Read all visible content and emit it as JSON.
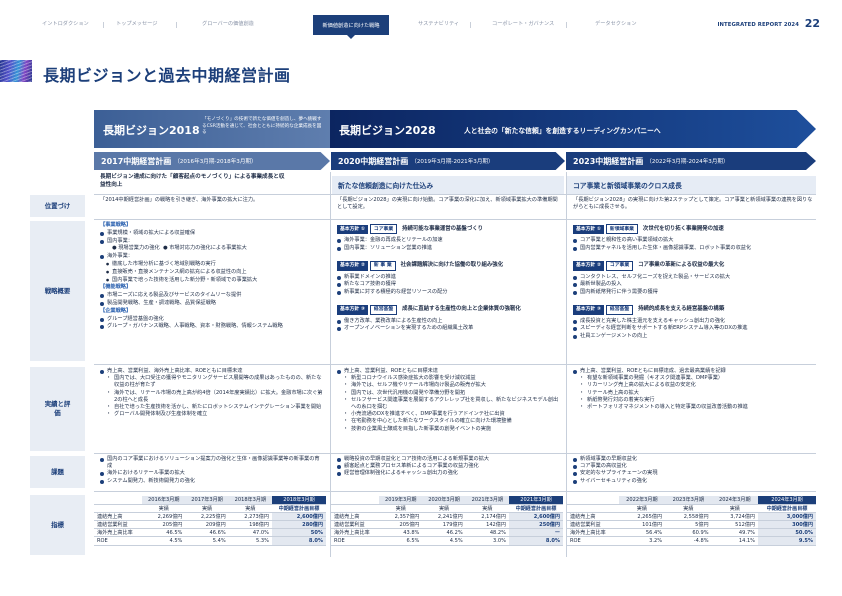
{
  "nav": {
    "items": [
      "イントロダクション",
      "トップメッセージ",
      "グローバーの価値創造",
      "新価値創造に向けた戦略",
      "サステナビリティ",
      "コーポレート・ガバナンス",
      "データセクション"
    ],
    "active_index": 3,
    "report_title": "INTEGRATED REPORT 2024",
    "page_number": "22"
  },
  "page_title": "長期ビジョンと過去中期経営計画",
  "vision2018": {
    "title": "長期ビジョン2018",
    "desc": "「モノづくり」の技術で新たな価値を創造し、夢へ挑戦するCSR活動を通じて、社会とともに持続的な企業成長を図る"
  },
  "vision2028": {
    "title": "長期ビジョン2028",
    "desc": "人と社会の「新たな信頼」を創造するリーディングカンパニーへ"
  },
  "plans": [
    {
      "title": "2017中期経営計画",
      "period": "（2016年3月期-2018年3月期）"
    },
    {
      "title": "2020中期経営計画",
      "period": "（2019年3月期-2021年3月期）"
    },
    {
      "title": "2023中期経営計画",
      "period": "（2022年3月期-2024年3月期）"
    }
  ],
  "row_labels": {
    "position": "位置づけ",
    "strategy": "戦略概要",
    "results": "実績と評価",
    "issues": "課題",
    "indicators": "指標"
  },
  "plan1": {
    "subtitle": "長期ビジョン達成に向けた「顧客起点のモノづくり」による事業成長と収益性向上",
    "position": "「2014中期経営計画」の戦略を引き継ぎ、海外事業の拡大に注力。",
    "strategy": {
      "biz_head": "【事業戦略】",
      "biz_items": [
        "事業規模・領域の拡大による収益確保",
        "国内事業："
      ],
      "domestic_subs": [
        "現場営業力の強化",
        "市場対応力の強化による事業拡大"
      ],
      "overseas": "海外事業：",
      "overseas_subs": [
        "徹底した市場分析に基づく地域別戦略の実行",
        "直接販売・直接メンテナンス網の拡充による収益性の向上",
        "国内事業で培った技術を活用した新分野・新領域での事業拡大"
      ],
      "func_head": "【機能戦略】",
      "func_items": [
        "市場ニーズに応える製品及びサービスのタイムリーな提供",
        "製品開発戦略、生産・調達戦略、品質保証戦略"
      ],
      "corp_head": "【企業戦略】",
      "corp_items": [
        "グループ経営基盤の強化",
        "グループ・ガバナンス戦略、人事戦略、資本・財務戦略、情報システム戦略"
      ]
    },
    "results": {
      "main": "売上高、営業利益、海外売上高比率、ROEともに目標未達",
      "subs": [
        "国内では、大口受注の獲得やモニタリングサービス展開等の成果はあったものの、新たな収益の柱が育たず",
        "海外では、リテール市場の売上高が約4倍（2014年度実績比）に拡大。金融市場に次ぐ第2の柱へと成長",
        "自社で培った生産技術を活かし、新たにロボットシステムインテグレーション事業を開始",
        "グローバル開発体制及び生産体制を確立"
      ]
    },
    "issues": [
      "国内のコア事業におけるソリューション提案力の強化と生体・画像認識事業等の新事業の育成",
      "海外におけるリテール事業の拡大",
      "システム開発力、新技術開発力の強化"
    ]
  },
  "plan2": {
    "subtitle": "新たな信頼創造に向けた仕込み",
    "position": "「長期ビジョン2028」の実現に向け始動。コア事業の深化に加え、新領域事業拡大の準備期間として設定。",
    "policies": [
      {
        "badge": "基本方針 ①",
        "tag": "コア事業",
        "title": "持続可能な事業運営の基盤づくり",
        "items": [
          "海外事業：金融の再成長とリテールの加速",
          "国内事業：ソリューション営業の推進"
        ]
      },
      {
        "badge": "基本方針 ②",
        "tag": "新 事 業",
        "title": "社会課題解決に向けた協働の取り組み強化",
        "items": [
          "新事業ドメインの推進",
          "新たなコア技術の獲得",
          "新事業に対する積極的な経営リソースの配分"
        ]
      },
      {
        "badge": "基本方針 ③",
        "tag": "経営基盤",
        "title": "成長に直結する生産性の向上と企業体質の強靭化",
        "items": [
          "働き方改革、業務改革による生産性の向上",
          "オープンイノベーションを実現するための組織風土改革"
        ]
      }
    ],
    "results": {
      "main": "売上高、営業利益、ROEともに目標未達",
      "subs": [
        "新型コロナウイルス感染症拡大の影響を受け減収減益",
        "海外では、セルフ機やリテール市場向け製品の販売が拡大",
        "国内では、次世代汎用機の開発や準備分野を開拓",
        "セルフサービス関連事業を展開するアクレレップ社を買収し、新たなビジネスモデル創出への糸口を掴む",
        "小売流通のDXを推進すべく、DMP事業を行うアドインテ社に出資",
        "在宅勤務を中心とした新たなワークスタイルの確立に向けた環境整備",
        "技術の企業風土醸成を目指した新事業の創発イベントの実施"
      ]
    },
    "issues": [
      "戦略投資の早期収益化とコア技術の活用による新規事業の拡大",
      "顧客起点と業務プロセス革新によるコア事業の収益力強化",
      "経営管理体制強化によるキャッシュ創出力の強化"
    ]
  },
  "plan3": {
    "subtitle": "コア事業と新領域事業のクロス成長",
    "position": "「長期ビジョン2028」の実現に向けた第2ステップとして策定。コア事業と新領域事業の連携を図りながらともに成長させる。",
    "policies": [
      {
        "badge": "基本方針 ①",
        "tag": "新領域事業",
        "title": "次世代を切り拓く事業開発の加速",
        "items": [
          "コア事業と親和性の高い事業領域の拡大",
          "国内営業チャネルを活用した生体・画像認識事業、ロボット事業の収益化"
        ]
      },
      {
        "badge": "基本方針 ②",
        "tag": "コア事業",
        "title": "コア事業の革新による収益の最大化",
        "items": [
          "コンタクトレス、セルフ化ニーズを捉えた製品・サービスの拡大",
          "最新世製品の投入",
          "国内新紙幣発行に伴う需要の獲得"
        ]
      },
      {
        "badge": "基本方針 ③",
        "tag": "経営基盤",
        "title": "持続的成長を支える経営基盤の構築",
        "items": [
          "成長投資と充実した株主還元を支えるキャッシュ創出力の強化",
          "スピーディな経営判断をサポートする新ERPシステム導入等のDXの推進",
          "社員エンゲージメントの向上"
        ]
      }
    ],
    "results": {
      "main": "売上高、営業利益、ROEともに目標達成、過去最高業績を記録",
      "subs": [
        "有望な新領域事業の発掘（キオスク関連事業、DMP事業）",
        "リカーリング売上高の拡大による収益の安定化",
        "リテール売上高の拡大",
        "新紙幣発行対応の着実な実行",
        "ポートフォリオマネジメントの導入と特定事業の収益改善活動の推進"
      ]
    },
    "issues": [
      "新領域事業の早期収益化",
      "コア事業の高収益化",
      "安定的なサプライチェーンの実現",
      "サイバーセキュリティの強化"
    ]
  },
  "tables": [
    {
      "periods": [
        "2016年3月期",
        "2017年3月期",
        "2018年3月期",
        "2018年3月期"
      ],
      "kinds": [
        "実績",
        "実績",
        "実績",
        "中期経営計画目標"
      ],
      "rows": [
        {
          "label": "連結売上高",
          "values": [
            "2,269億円",
            "2,225億円",
            "2,273億円",
            "2,600億円"
          ]
        },
        {
          "label": "連結営業利益",
          "values": [
            "205億円",
            "209億円",
            "198億円",
            "280億円"
          ]
        },
        {
          "label": "海外売上高比率",
          "values": [
            "46.5%",
            "46.6%",
            "47.0%",
            "50%"
          ]
        },
        {
          "label": "ROE",
          "values": [
            "4.5%",
            "5.4%",
            "5.3%",
            "8.0%"
          ]
        }
      ]
    },
    {
      "periods": [
        "2019年3月期",
        "2020年3月期",
        "2021年3月期",
        "2021年3月期"
      ],
      "kinds": [
        "実績",
        "実績",
        "実績",
        "中期経営計画目標"
      ],
      "rows": [
        {
          "label": "連結売上高",
          "values": [
            "2,357億円",
            "2,241億円",
            "2,174億円",
            "2,600億円"
          ]
        },
        {
          "label": "連結営業利益",
          "values": [
            "205億円",
            "179億円",
            "142億円",
            "250億円"
          ]
        },
        {
          "label": "海外売上高比率",
          "values": [
            "43.8%",
            "46.2%",
            "48.2%",
            "ー"
          ]
        },
        {
          "label": "ROE",
          "values": [
            "6.5%",
            "4.5%",
            "3.0%",
            "8.0%"
          ]
        }
      ]
    },
    {
      "periods": [
        "2022年3月期",
        "2023年3月期",
        "2024年3月期",
        "2024年3月期"
      ],
      "kinds": [
        "実績",
        "実績",
        "実績",
        "中期経営計画目標"
      ],
      "rows": [
        {
          "label": "連結売上高",
          "values": [
            "2,265億円",
            "2,558億円",
            "3,724億円",
            "3,000億円"
          ]
        },
        {
          "label": "連結営業利益",
          "values": [
            "101億円",
            "5億円",
            "512億円",
            "300億円"
          ]
        },
        {
          "label": "海外売上高比率",
          "values": [
            "56.4%",
            "60.9%",
            "49.7%",
            "50.0%"
          ]
        },
        {
          "label": "ROE",
          "values": [
            "3.2%",
            "-4.8%",
            "14.1%",
            "9.5%"
          ]
        }
      ]
    }
  ],
  "colors": {
    "primary": "#1c3f7a",
    "light_panel": "#e8edf4",
    "accent_blue": "#2c62b0"
  }
}
